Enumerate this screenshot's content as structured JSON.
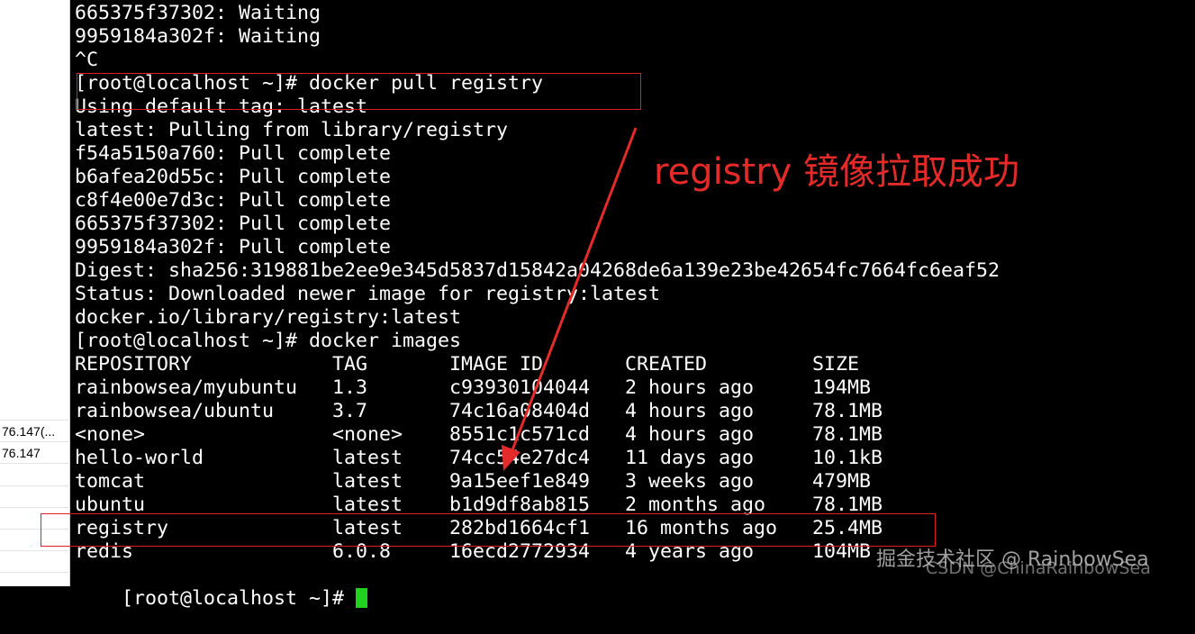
{
  "sidebar": {
    "items": [
      "76.147(...",
      "76.147"
    ]
  },
  "terminal": {
    "lines_before_table": [
      "665375f37302: Waiting",
      "9959184a302f: Waiting",
      "^C",
      "[root@localhost ~]# docker pull registry",
      "Using default tag: latest",
      "latest: Pulling from library/registry",
      "f54a5150a760: Pull complete",
      "b6afea20d55c: Pull complete",
      "c8f4e00e7d3c: Pull complete",
      "665375f37302: Pull complete",
      "9959184a302f: Pull complete",
      "Digest: sha256:319881be2ee9e345d5837d15842a04268de6a139e23be42654fc7664fc6eaf52",
      "Status: Downloaded newer image for registry:latest",
      "docker.io/library/registry:latest",
      "[root@localhost ~]# docker images"
    ],
    "table": {
      "headers": [
        "REPOSITORY",
        "TAG",
        "IMAGE ID",
        "CREATED",
        "SIZE"
      ],
      "rows": [
        [
          "rainbowsea/myubuntu",
          "1.3",
          "c93930104044",
          "2 hours ago",
          "194MB"
        ],
        [
          "rainbowsea/ubuntu",
          "3.7",
          "74c16a08404d",
          "4 hours ago",
          "78.1MB"
        ],
        [
          "<none>",
          "<none>",
          "8551c1c571cd",
          "4 hours ago",
          "78.1MB"
        ],
        [
          "hello-world",
          "latest",
          "74cc54e27dc4",
          "11 days ago",
          "10.1kB"
        ],
        [
          "tomcat",
          "latest",
          "9a15eef1e849",
          "3 weeks ago",
          "479MB"
        ],
        [
          "ubuntu",
          "latest",
          "b1d9df8ab815",
          "2 months ago",
          "78.1MB"
        ],
        [
          "registry",
          "latest",
          "282bd1664cf1",
          "16 months ago",
          "25.4MB"
        ],
        [
          "redis",
          "6.0.8",
          "16ecd2772934",
          "4 years ago",
          "104MB"
        ]
      ]
    },
    "prompt": "[root@localhost ~]# "
  },
  "annotation": "registry 镜像拉取成功",
  "watermark": "掘金技术社区 @ RainbowSea",
  "watermark2": "CSDN @ChinaRainbowSea",
  "colors": {
    "background": "#000000",
    "text": "#ffffff",
    "highlight": "#e02020",
    "cursor": "#22d11f"
  }
}
